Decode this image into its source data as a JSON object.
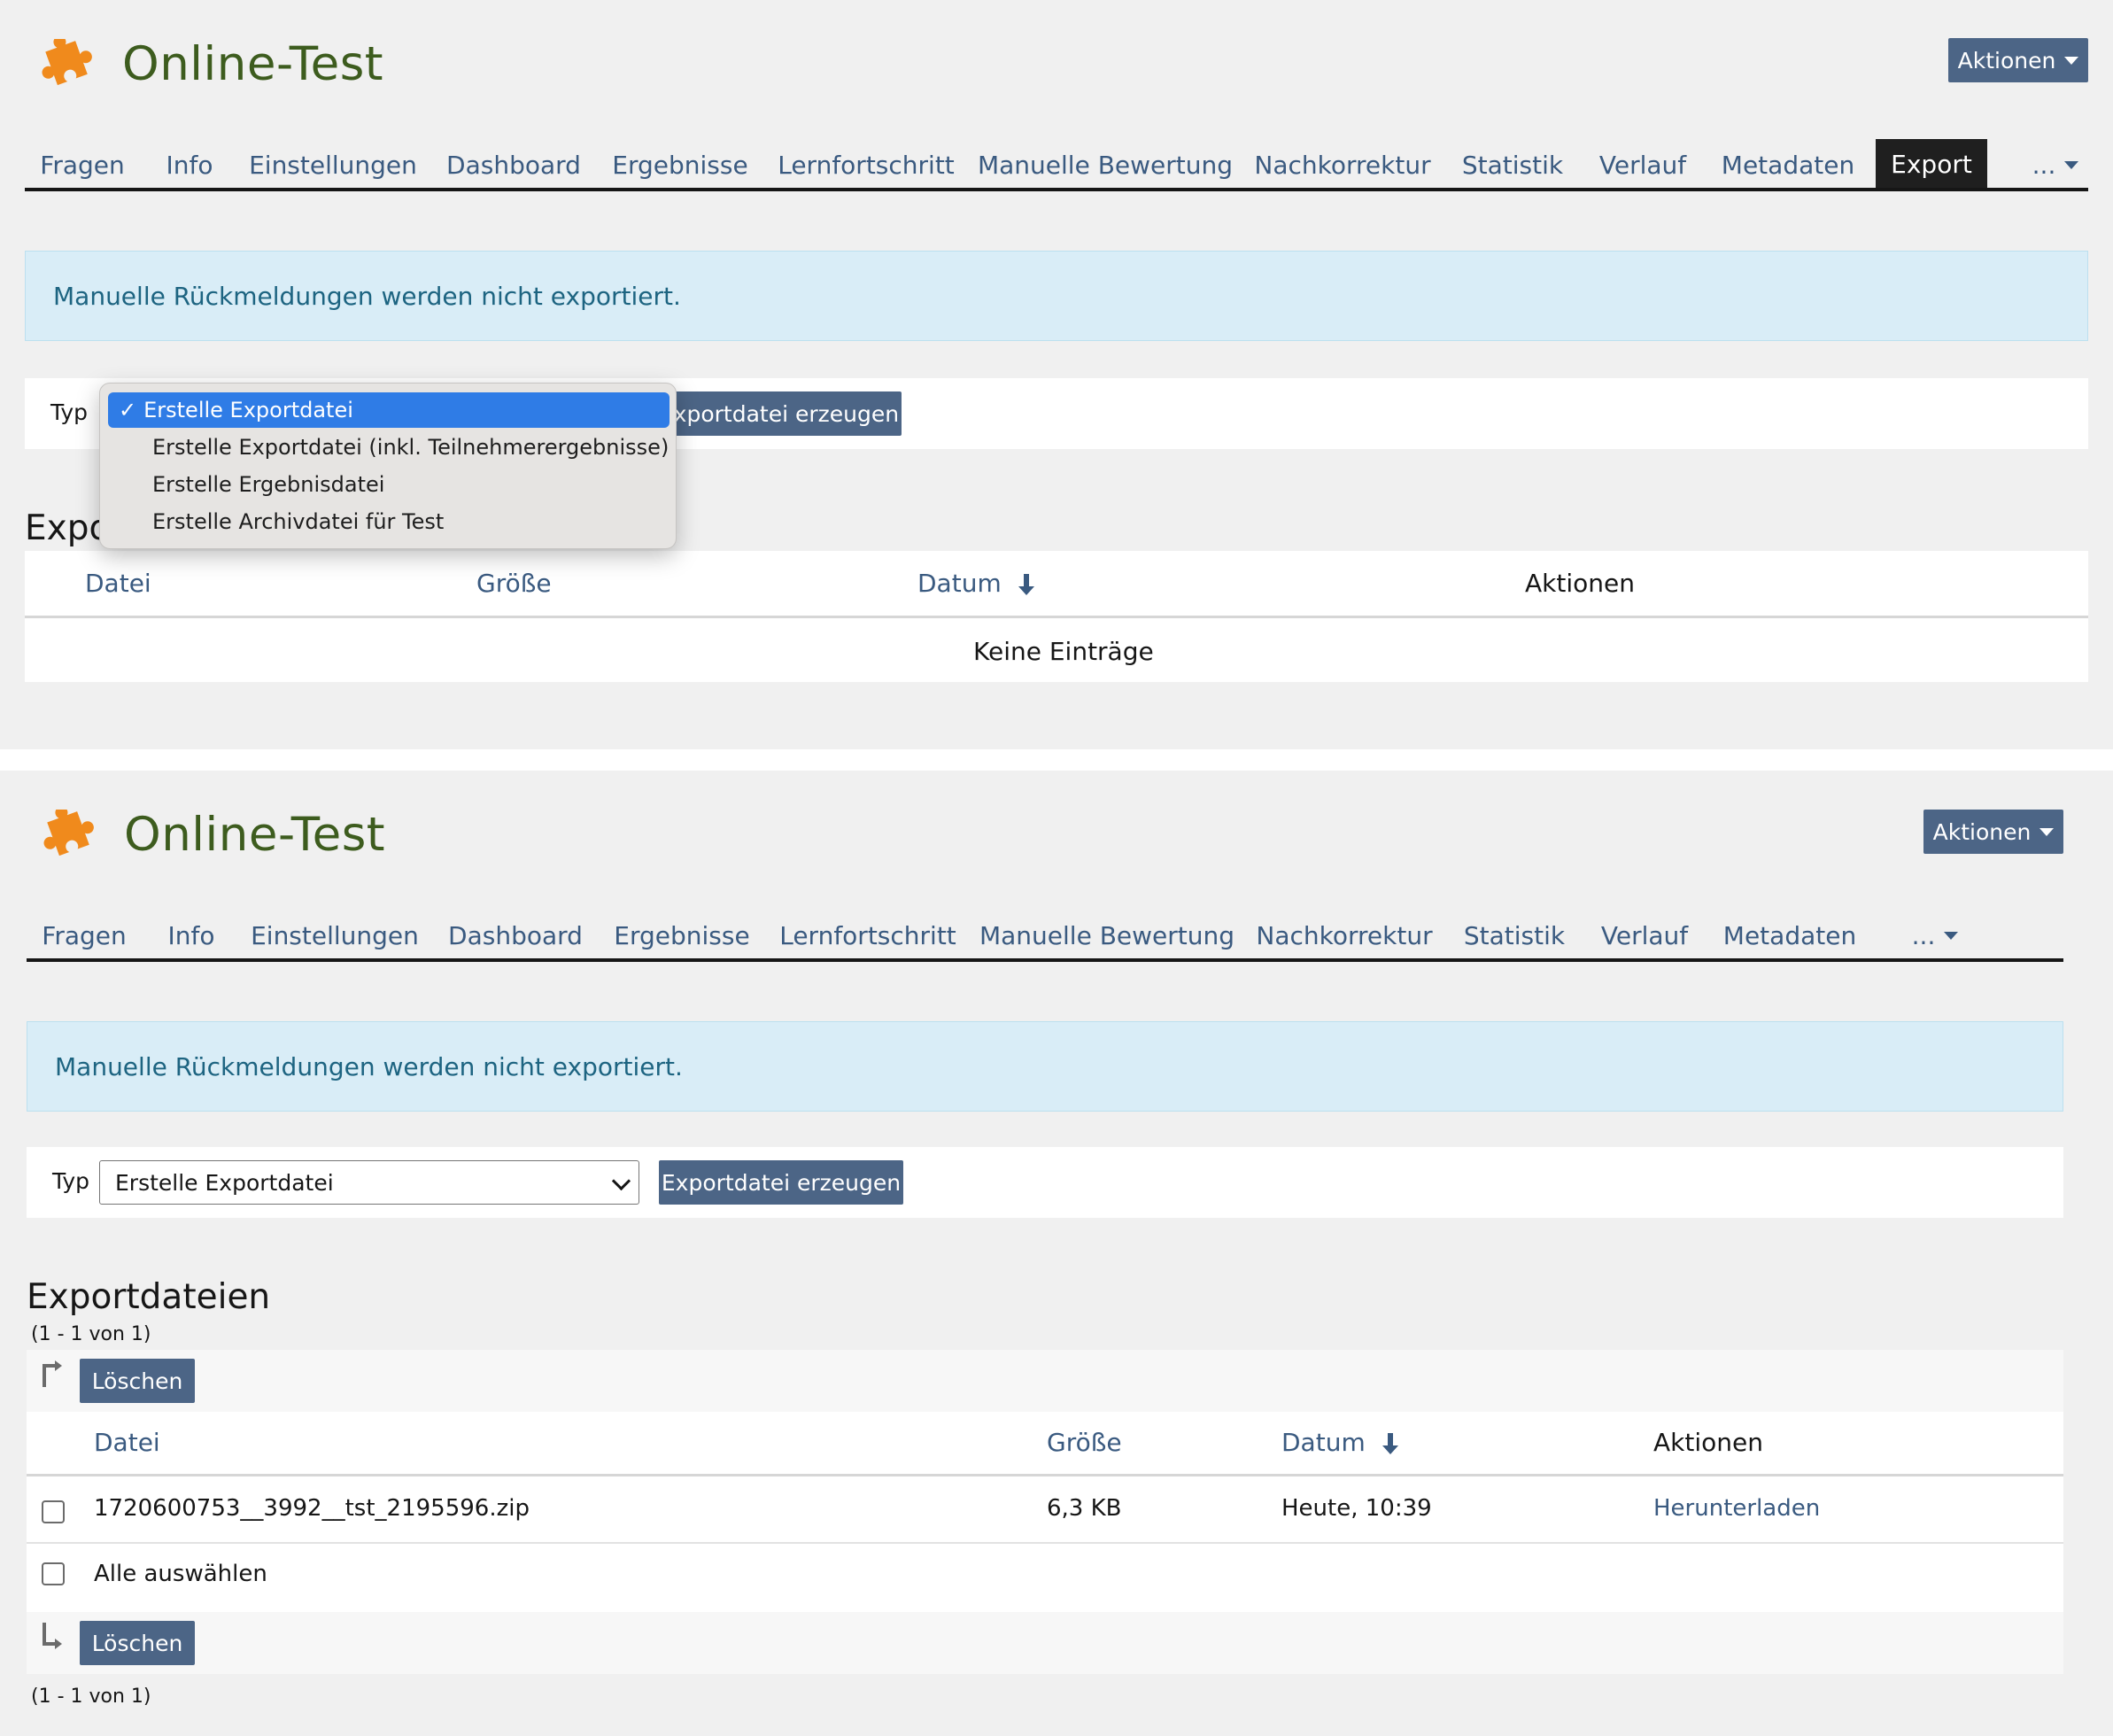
{
  "colors": {
    "brand_title": "#3d5c1e",
    "primary_button": "#4c6586",
    "link": "#3a5a80",
    "info_bg": "#d9edf7",
    "info_text": "#1d6481",
    "active_tab_bg": "#1f1f1f",
    "dropdown_selected": "#2f7ce6",
    "logo": "#f08a1c"
  },
  "top": {
    "logo_icon": "puzzle-piece-icon",
    "title": "Online-Test",
    "actions_label": "Aktionen",
    "tabs": [
      {
        "label": "Fragen"
      },
      {
        "label": "Info"
      },
      {
        "label": "Einstellungen"
      },
      {
        "label": "Dashboard"
      },
      {
        "label": "Ergebnisse"
      },
      {
        "label": "Lernfortschritt"
      },
      {
        "label": "Manuelle Bewertung"
      },
      {
        "label": "Nachkorrektur"
      },
      {
        "label": "Statistik"
      },
      {
        "label": "Verlauf"
      },
      {
        "label": "Metadaten"
      },
      {
        "label": "Export",
        "active": true
      },
      {
        "label": "..."
      }
    ],
    "info_message": "Manuelle Rückmeldungen werden nicht exportiert.",
    "type_label": "Typ",
    "create_button": "Exportdatei erzeugen",
    "dropdown_options": [
      {
        "label": "Erstelle Exportdatei",
        "selected": true
      },
      {
        "label": "Erstelle Exportdatei (inkl. Teilnehmerergebnisse)"
      },
      {
        "label": "Erstelle Ergebnisdatei"
      },
      {
        "label": "Erstelle Archivdatei für Test"
      }
    ],
    "check_glyph": "✓",
    "section_title_partial": "Expo",
    "table": {
      "col_file": "Datei",
      "col_size": "Größe",
      "col_date": "Datum",
      "col_actions": "Aktionen",
      "empty": "Keine Einträge"
    }
  },
  "bottom": {
    "logo_icon": "puzzle-piece-icon",
    "title": "Online-Test",
    "actions_label": "Aktionen",
    "tabs": [
      {
        "label": "Fragen"
      },
      {
        "label": "Info"
      },
      {
        "label": "Einstellungen"
      },
      {
        "label": "Dashboard"
      },
      {
        "label": "Ergebnisse"
      },
      {
        "label": "Lernfortschritt"
      },
      {
        "label": "Manuelle Bewertung"
      },
      {
        "label": "Nachkorrektur"
      },
      {
        "label": "Statistik"
      },
      {
        "label": "Verlauf"
      },
      {
        "label": "Metadaten"
      },
      {
        "label": "..."
      }
    ],
    "info_message": "Manuelle Rückmeldungen werden nicht exportiert.",
    "type_label": "Typ",
    "type_value": "Erstelle Exportdatei",
    "create_button": "Exportdatei erzeugen",
    "section_title": "Exportdateien",
    "range_top": "(1 - 1 von 1)",
    "range_bottom": "(1 - 1 von 1)",
    "delete_label": "Löschen",
    "select_all": "Alle auswählen",
    "table": {
      "col_file": "Datei",
      "col_size": "Größe",
      "col_date": "Datum",
      "col_actions": "Aktionen",
      "rows": [
        {
          "file": "1720600753__3992__tst_2195596.zip",
          "size": "6,3 KB",
          "date": "Heute, 10:39",
          "action": "Herunterladen"
        }
      ]
    }
  }
}
